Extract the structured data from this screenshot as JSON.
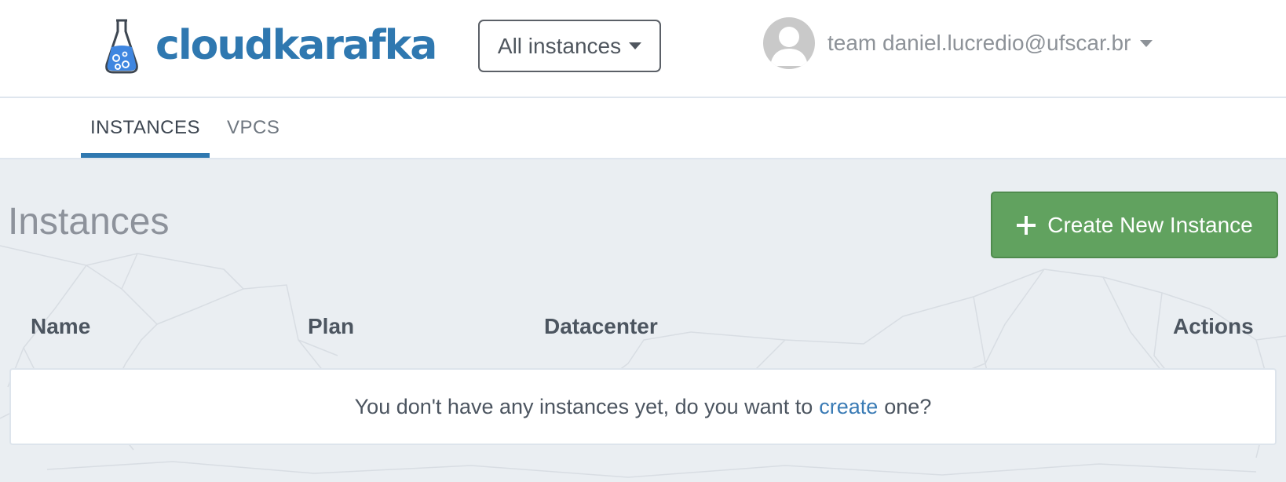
{
  "brand": {
    "name": "cloudkarafka",
    "color": "#2f78b0"
  },
  "instance_filter": {
    "selected": "All instances",
    "icon": "chevron-down-icon"
  },
  "user": {
    "label": "team daniel.lucredio@ufscar.br",
    "icon": "user-avatar-icon"
  },
  "tabs": [
    {
      "label": "INSTANCES",
      "active": true
    },
    {
      "label": "VPCS",
      "active": false
    }
  ],
  "page": {
    "title": "Instances"
  },
  "create_button": {
    "label": "Create New Instance",
    "icon": "plus-icon",
    "color": "#61a25f"
  },
  "table": {
    "columns": [
      "Name",
      "Plan",
      "Datacenter",
      "Actions"
    ],
    "empty_state": {
      "before": "You don't have any instances yet, do you want to",
      "link": "create",
      "after": "one?"
    }
  }
}
